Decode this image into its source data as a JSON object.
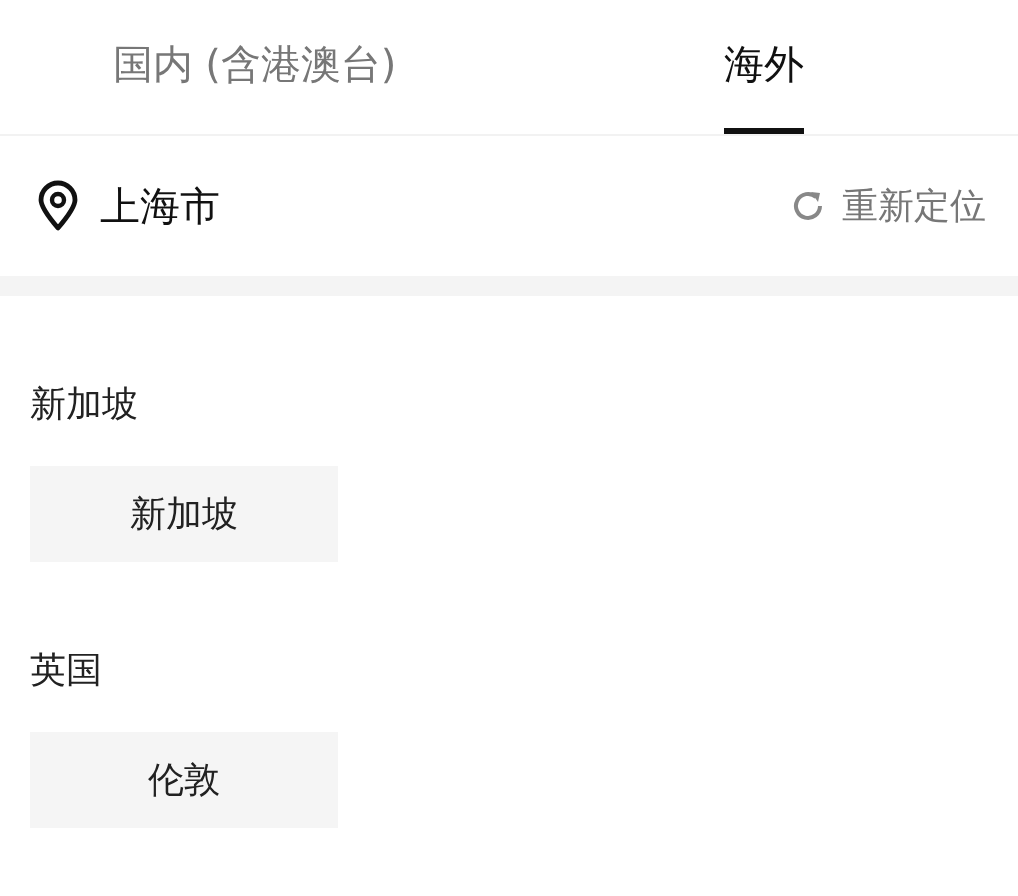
{
  "tabs": [
    {
      "label": "国内 (含港澳台)",
      "selected": false
    },
    {
      "label": "海外",
      "selected": true
    }
  ],
  "location": {
    "city": "上海市",
    "relocate": "重新定位"
  },
  "regions": [
    {
      "name": "新加坡",
      "cities": [
        "新加坡"
      ]
    },
    {
      "name": "英国",
      "cities": [
        "伦敦"
      ]
    }
  ]
}
